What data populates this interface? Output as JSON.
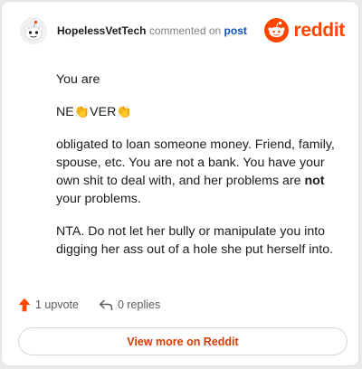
{
  "header": {
    "username": "HopelessVetTech",
    "action_text": " commented on ",
    "post_link": "post",
    "brand_name": "reddit"
  },
  "comment": {
    "line1": "You are",
    "emphasis_part1": "NE",
    "emphasis_part2": "VER",
    "emphasis_emoji": "👏",
    "para3_text": "obligated to loan someone money. Friend, family, spouse, etc. You are not a bank. You have your own shit to deal with, and her problems are ",
    "para3_bold": "not",
    "para3_end": " your problems.",
    "para4": "NTA. Do not let her bully or manipulate you into digging her ass out of a hole she put herself into."
  },
  "actions": {
    "upvote_label": "1 upvote",
    "replies_label": "0 replies"
  },
  "footer": {
    "view_more_label": "View more on Reddit"
  },
  "colors": {
    "brand": "#ff4500",
    "link": "#0a53b5",
    "button_text": "#d93a00"
  },
  "icons": {
    "avatar": "snoo-avatar-icon",
    "brand": "reddit-logo-icon",
    "upvote": "upvote-arrow-icon",
    "replies": "reply-arrow-icon"
  }
}
